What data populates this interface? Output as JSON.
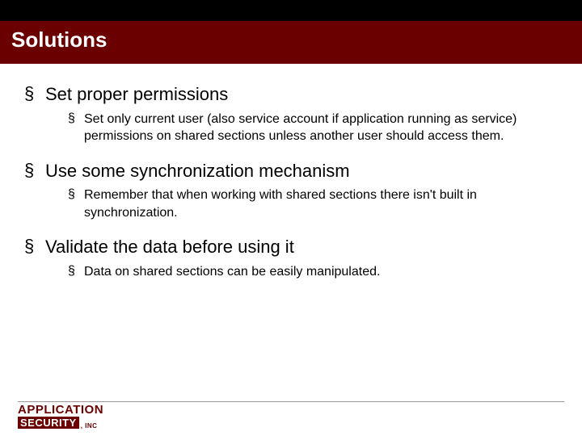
{
  "slide": {
    "title": "Solutions",
    "bullets": [
      {
        "text": "Set proper permissions",
        "sub": [
          "Set only current user (also service account if application running as service) permissions on shared sections unless another user should access them."
        ]
      },
      {
        "text": "Use some synchronization mechanism",
        "sub": [
          "Remember that when working with shared sections there isn't built in synchronization."
        ]
      },
      {
        "text": "Validate the data before using it",
        "sub": [
          "Data on shared sections can be easily manipulated."
        ]
      }
    ]
  },
  "logo": {
    "line1": "APPLICATION",
    "line2": "SECURITY",
    "suffix": ", INC"
  }
}
